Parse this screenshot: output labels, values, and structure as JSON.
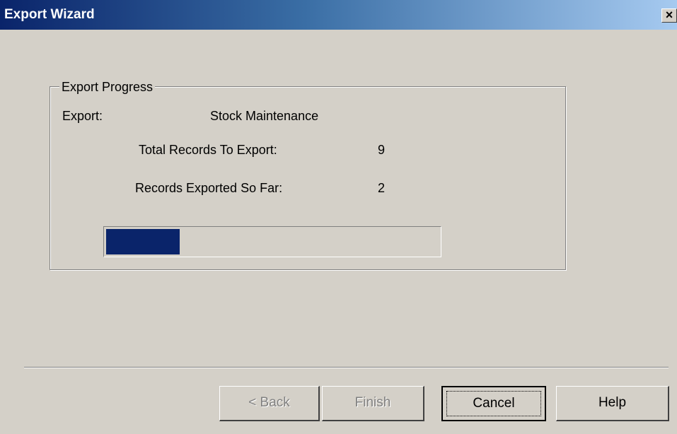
{
  "window": {
    "title": "Export Wizard",
    "close_glyph": "✕"
  },
  "group": {
    "label": "Export Progress"
  },
  "export": {
    "label": "Export:",
    "value": "Stock Maintenance"
  },
  "stats": {
    "total_label": "Total Records To Export:",
    "total_value": "9",
    "sofar_label": "Records Exported So Far:",
    "sofar_value": "2"
  },
  "progress": {
    "fraction": 0.222,
    "fill_color": "#0a246a"
  },
  "buttons": {
    "back_label": "< Back",
    "finish_label": "Finish",
    "cancel_label": "Cancel",
    "help_label": "Help"
  }
}
